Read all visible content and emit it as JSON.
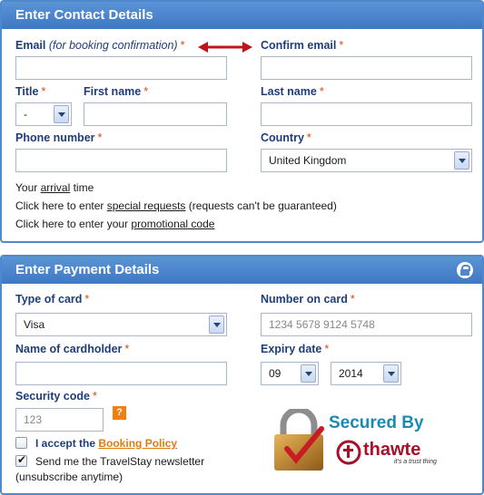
{
  "contact": {
    "header": "Enter Contact Details",
    "email_label": "Email",
    "email_note": "(for booking confirmation)",
    "confirm_email_label": "Confirm email",
    "title_label": "Title",
    "title_value": "-",
    "first_name_label": "First name",
    "last_name_label": "Last name",
    "phone_label": "Phone number",
    "country_label": "Country",
    "country_value": "United Kingdom",
    "required_mark": "*",
    "arrival_pre": "Your ",
    "arrival_link": "arrival",
    "arrival_post": " time",
    "special_pre": "Click here to enter ",
    "special_link": "special requests",
    "special_post": " (requests can't be guaranteed)",
    "promo_pre": "Click here to enter your ",
    "promo_link": "promotional code"
  },
  "payment": {
    "header": "Enter Payment Details",
    "card_type_label": "Type of card",
    "card_type_value": "Visa",
    "card_number_label": "Number on card",
    "card_number_placeholder": "1234 5678 9124 5748",
    "cardholder_label": "Name of cardholder",
    "expiry_label": "Expiry date",
    "expiry_month": "09",
    "expiry_year": "2014",
    "security_label": "Security code",
    "security_placeholder": "123",
    "help_symbol": "?",
    "accept_pre": "I accept the ",
    "accept_link": "Booking Policy",
    "newsletter_line1": "Send me the TravelStay newsletter",
    "newsletter_line2": "(unsubscribe anytime)",
    "secured_text": "Secured By",
    "thawte_name": "thawte",
    "thawte_tagline": "it's a trust thing"
  },
  "colors": {
    "header_blue": "#4f88cc",
    "label_navy": "#1f3d7a",
    "required_orange": "#d04a14",
    "link_orange": "#e07a12",
    "arrow_red": "#c0141c"
  }
}
